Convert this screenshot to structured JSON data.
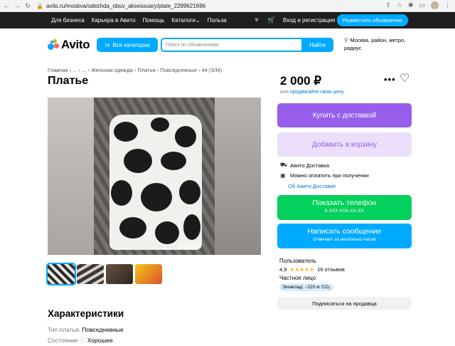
{
  "browser": {
    "url": "avito.ru/moskva/odezhda_obuv_aksessuary/plate_2289621696"
  },
  "topnav": {
    "links": [
      "Для бизнеса",
      "Карьера в Авито",
      "Помощь",
      "Каталоги",
      "Польза"
    ],
    "catalogs_chevron": "⌄",
    "login": "Вход и регистрация",
    "post_ad": "Разместить объявление"
  },
  "header": {
    "logo": "Avito",
    "categories_button": "Все категории",
    "search_placeholder": "Поиск по объявлениям",
    "search_button": "Найти",
    "location": "Москва, район, метро, радиус"
  },
  "breadcrumb": "Главная › ... › ... › Женская одежда › Платья › Повседневные › 44 (S/M)",
  "listing": {
    "title": "Платье",
    "price": "2 000 ₽",
    "price_note_prefix": "или",
    "price_note_link": "продвигайте свою цену",
    "watermark": "Avito"
  },
  "actions": {
    "buy_delivery": "Купить с доставкой",
    "add_to_cart": "Добавить в корзину",
    "delivery_service": "Авито Доставка",
    "pay_on_receipt": "Можно оплатить при получении",
    "about_delivery": "Об Авито Доставке",
    "show_phone": "Показать телефон",
    "phone_mask": "8 XXX XXX-XX-XX",
    "write_message": "Написать сообщение",
    "reply_time": "Отвечает за несколько часов",
    "subscribe": "Подписаться на продавца"
  },
  "seller": {
    "name": "Пользователь",
    "rating": "4,9",
    "stars": "★★★★★",
    "reviews": "16 отзывов",
    "type": "Частное лицо",
    "eco": "Экокклад: ~220 кг CO₂"
  },
  "characteristics": {
    "title": "Характеристики",
    "rows": [
      {
        "label": "Тип платья:",
        "value": "Повседневные"
      },
      {
        "label": "Состояние",
        "value": "Хорошее"
      }
    ]
  },
  "colors": {
    "accent": "#00aaff",
    "buy": "#965eeb",
    "phone": "#02d15c"
  }
}
